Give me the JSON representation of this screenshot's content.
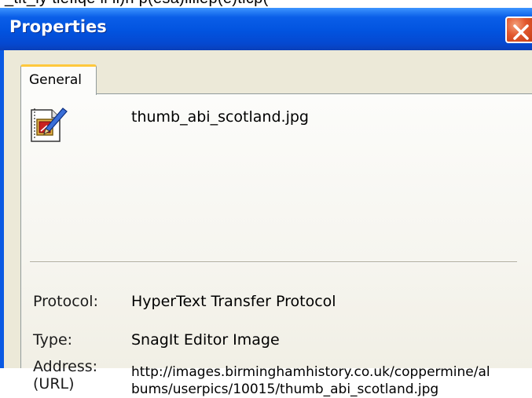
{
  "window": {
    "partial_text_above": "_tit_ly tiefiqe ii ii)h p(esa)iiiiep(e)ticp(",
    "title": "Properties",
    "close_icon": "close-icon"
  },
  "tabs": [
    {
      "label": "General",
      "active": true
    }
  ],
  "file": {
    "icon": "image-file-icon",
    "name": "thumb_abi_scotland.jpg"
  },
  "properties": {
    "protocol_label": "Protocol:",
    "protocol_value": "HyperText Transfer Protocol",
    "type_label": "Type:",
    "type_value": "SnagIt Editor Image",
    "address_label": "Address:\n(URL)",
    "address_value": "http://images.birminghamhistory.co.uk/coppermine/al\nbums/userpics/10015/thumb_abi_scotland.jpg"
  },
  "colors": {
    "titlebar": "#0253df",
    "close_button": "#e2582e",
    "dialog_background": "#ece9d8",
    "tab_highlight": "#ffc83c"
  }
}
